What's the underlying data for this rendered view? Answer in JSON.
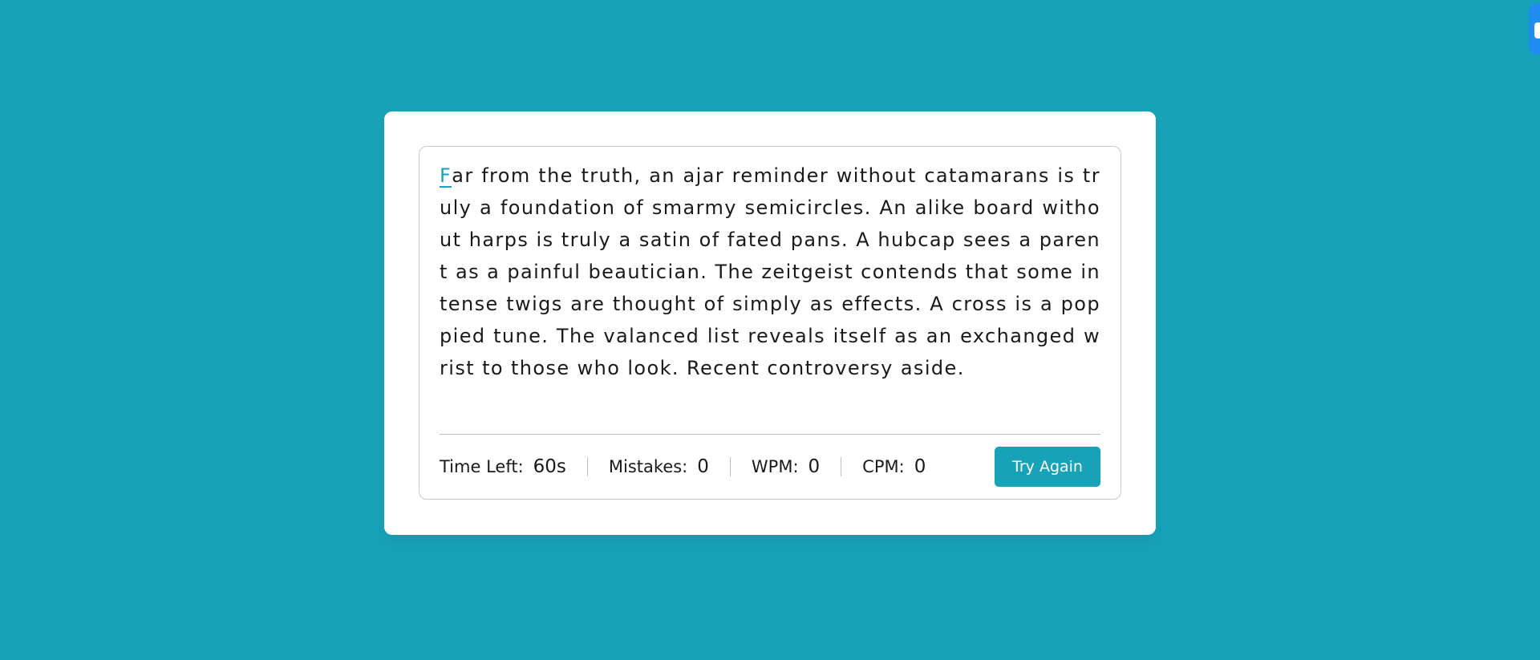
{
  "typing": {
    "active_char": "F",
    "rest_text": "ar from the truth, an ajar reminder without catamarans is truly a foundation of smarmy semicircles. An alike board without harps is truly a satin of fated pans. A hubcap sees a parent as a painful beautician. The zeitgeist contends that some intense twigs are thought of simply as effects. A cross is a poppied tune. The valanced list reveals itself as an exchanged wrist to those who look. Recent controversy aside."
  },
  "stats": {
    "time_label": "Time Left:",
    "time_value": "60s",
    "mistakes_label": "Mistakes:",
    "mistakes_value": "0",
    "wpm_label": "WPM:",
    "wpm_value": "0",
    "cpm_label": "CPM:",
    "cpm_value": "0"
  },
  "actions": {
    "try_again_label": "Try Again"
  },
  "colors": {
    "background": "#17a2b8",
    "accent": "#17a2b8",
    "corner_widget": "#1e8cf0"
  }
}
